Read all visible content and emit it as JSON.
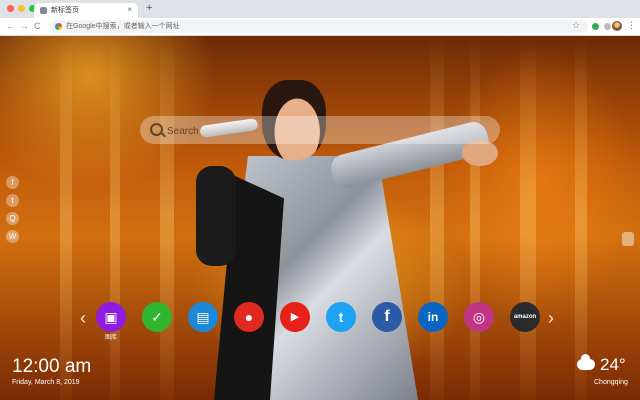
{
  "browser": {
    "tab_title": "新标签页",
    "tab_close": "×",
    "new_tab": "+",
    "back": "←",
    "forward": "→",
    "reload": "C",
    "address_placeholder": "在Google中搜索，或者输入一个网址",
    "bookmark_star": "☆",
    "menu": "⋮"
  },
  "search": {
    "placeholder": "Search"
  },
  "social": [
    {
      "icon": "facebook-icon",
      "glyph": "f"
    },
    {
      "icon": "twitter-icon",
      "glyph": "t"
    },
    {
      "icon": "qq-icon",
      "glyph": "Q"
    },
    {
      "icon": "wechat-icon",
      "glyph": "W"
    }
  ],
  "apps": {
    "prev": "‹",
    "next": "›",
    "items": [
      {
        "name": "gallery",
        "glyph": "▣",
        "color": "#8e1de0",
        "label": "图库"
      },
      {
        "name": "check",
        "glyph": "✓",
        "color": "#2fb52f",
        "label": ""
      },
      {
        "name": "notes",
        "glyph": "▤",
        "color": "#1e88d8",
        "label": ""
      },
      {
        "name": "game",
        "glyph": "●",
        "color": "#e02a1f",
        "label": ""
      },
      {
        "name": "youtube",
        "glyph": "▶",
        "color": "#e62117",
        "label": ""
      },
      {
        "name": "twitter",
        "glyph": "t",
        "color": "#1da1f2",
        "label": ""
      },
      {
        "name": "facebook",
        "glyph": "f",
        "color": "#2d5aa6",
        "label": ""
      },
      {
        "name": "linkedin",
        "glyph": "in",
        "color": "#0a66c2",
        "label": ""
      },
      {
        "name": "instagram",
        "glyph": "◎",
        "color": "#c13584",
        "label": ""
      },
      {
        "name": "amazon",
        "glyph": "amazon",
        "color": "#2b2b2b",
        "label": ""
      }
    ]
  },
  "clock": {
    "time": "12:00 am",
    "date": "Friday, March 8, 2019"
  },
  "weather": {
    "temp": "24°",
    "city": "Chongqing"
  }
}
